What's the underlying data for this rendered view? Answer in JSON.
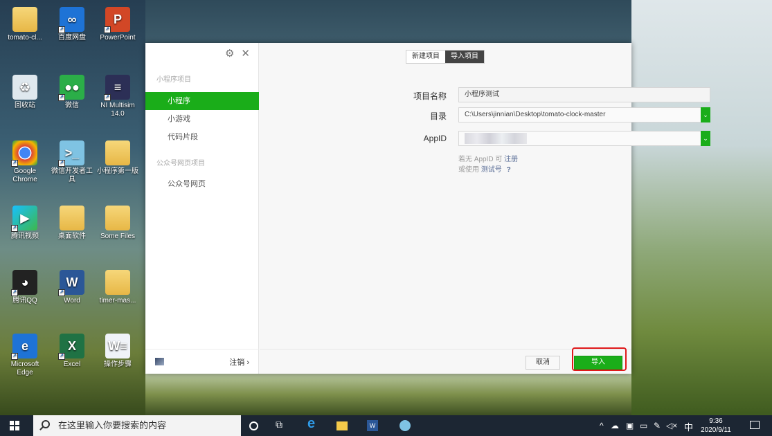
{
  "desktop": {
    "icons": [
      {
        "label": "tomato-cl...",
        "icon": "folder-icon"
      },
      {
        "label": "百度网盘",
        "icon": "baidu-netdisk-icon"
      },
      {
        "label": "PowerPoint",
        "icon": "powerpoint-icon"
      },
      {
        "label": "回收站",
        "icon": "recycle-bin-icon"
      },
      {
        "label": "微信",
        "icon": "wechat-icon"
      },
      {
        "label": "NI Multisim 14.0",
        "icon": "multisim-icon"
      },
      {
        "label": "Google Chrome",
        "icon": "chrome-icon"
      },
      {
        "label": "微信开发者工具",
        "icon": "wechat-devtools-icon"
      },
      {
        "label": "小程序第一版",
        "icon": "folder-icon"
      },
      {
        "label": "腾讯视频",
        "icon": "tencent-video-icon"
      },
      {
        "label": "桌面软件",
        "icon": "folder-icon"
      },
      {
        "label": "Some Files",
        "icon": "folder-icon"
      },
      {
        "label": "腾讯QQ",
        "icon": "qq-icon"
      },
      {
        "label": "Word",
        "icon": "word-icon"
      },
      {
        "label": "timer-mas...",
        "icon": "folder-icon"
      },
      {
        "label": "Microsoft Edge",
        "icon": "edge-icon"
      },
      {
        "label": "Excel",
        "icon": "excel-icon"
      },
      {
        "label": "操作步骤",
        "icon": "word-doc-icon"
      }
    ]
  },
  "sidebar": {
    "section1_title": "小程序项目",
    "items": [
      {
        "label": "小程序"
      },
      {
        "label": "小游戏"
      },
      {
        "label": "代码片段"
      }
    ],
    "section2_title": "公众号网页项目",
    "item_web": "公众号网页",
    "logout_label": "注销 ›"
  },
  "tabs": [
    {
      "label": "新建项目"
    },
    {
      "label": "导入项目"
    }
  ],
  "form": {
    "name_label": "项目名称",
    "name_value": "小程序测试",
    "dir_label": "目录",
    "dir_value": "C:\\Users\\jinnian\\Desktop\\tomato-clock-master",
    "appid_label": "AppID",
    "hint1_prefix": "若无 AppID 可",
    "hint1_link": "注册",
    "hint2_prefix": "或使用",
    "hint2_link": "测试号",
    "hint2_q": "?"
  },
  "buttons": {
    "cancel": "取消",
    "import": "导入"
  },
  "taskbar": {
    "search_placeholder": "在这里输入你要搜索的内容",
    "ime": "中",
    "time": "9:36",
    "date": "2020/9/11"
  },
  "colors": {
    "accent": "#1aad19",
    "highlight": "#e0191b"
  }
}
